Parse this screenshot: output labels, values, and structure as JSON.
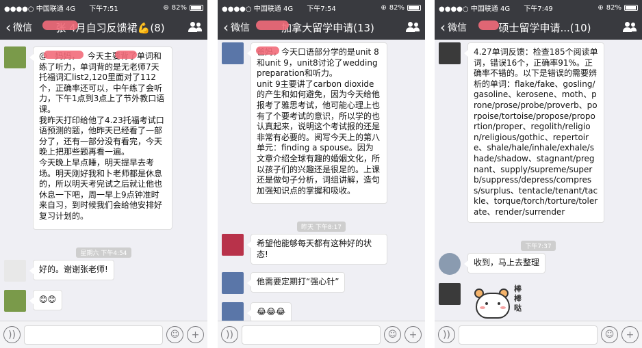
{
  "status": {
    "carrier": "●●●●○ 中国联通  4G",
    "battery": "82%",
    "battery_level": 0.82
  },
  "phones": [
    {
      "time": "下午7:51",
      "back_label": "微信",
      "title": "张 4月自习反馈裙💪(8)",
      "timestamps": [
        "星期六 下午4:54"
      ],
      "messages": [
        "@   妈妈，   今天主要背了单词和练了听力，单词背的是无老师7天托福词汇list2,120里面对了112个，正确率还可以，中午练了会听力，下午1点到3点上了节外教口语课。\n我昨天打印给他了4.23托福考试口语预测的题，他昨天已经看了一部分了，还有一部分没有看完，今天晚上把那些题再看一遍。\n今天晚上早点睡，明天提早去考场。明天刚好我和卜老师都是休息的，所以明天考完试之后就让他也休息一下吧，周一早上9点钟准时来自习，到时候我们会给他安排好复习计划的。",
        "好的。谢谢张老师!",
        "😊😊"
      ]
    },
    {
      "time": "下午7:54",
      "back_label": "微信",
      "title": "加拿大留学申请(13)",
      "timestamps": [
        "昨天 下午8:17"
      ],
      "messages": [
        "爸妈，今天口语部分学的是unit 8和unit 9，unit8讨论了wedding preparation和听力。\nunit 9主要讲了carbon dioxide的产生和如何避免，因为今天给他报考了雅思考试，他可能心理上也有了个要考试的意识，所以学的也认真起来，说明这个考试报的还是非常有必要的。阅写今天上的第八单元：finding a spouse。因为文章介绍全球有趣的婚姻文化，所以孩子们的兴趣还是很足的。上课还是做句子分析，词组讲解，造句加强知识点的掌握和吸收。",
        "希望他能够每天都有这种好的状态!",
        "他需要定期打“强心针”",
        "😂😂😂"
      ]
    },
    {
      "time": "下午7:49",
      "back_label": "微信",
      "title": "硕士留学申请...(10)",
      "timestamps": [
        "下午7:37"
      ],
      "messages": [
        "4.27单词反馈：检查185个阅读单词，错误16个，正确率91%。正确率不错的。以下是错误的需要辨析的单词：flake/fake、gosling/gasoline、kerosene、moth、prone/prose/probe/proverb、porpoise/tortoise/propose/proportion/proper、regolith/religion/religious/gothic、repertoire、shale/hale/inhale/exhale/shade/shadow、stagnant/pregnant、supply/supreme/superb/suppress/depress/compress/surplus、tentacle/tenant/tackle、torque/torch/torture/tolerate、render/surrender",
        "收到，马上去整理"
      ],
      "sticker_text": "棒棒哒"
    }
  ],
  "input_icons": [
    "voice-icon",
    "emoji-icon",
    "plus-icon"
  ]
}
